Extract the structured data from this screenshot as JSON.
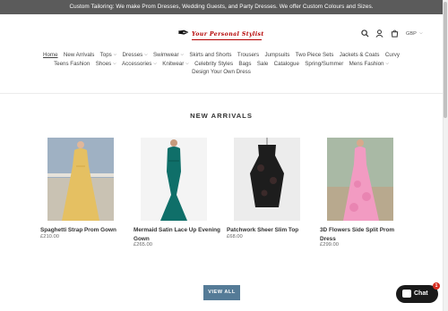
{
  "announcement": "Custom Tailoring: We make Prom Dresses, Wedding Guests, and Party Dresses. We offer Custom Colours and Sizes.",
  "logo": {
    "text": "Your Personal Stylist"
  },
  "header": {
    "currency": "GBP"
  },
  "nav": {
    "row1": [
      {
        "label": "Home",
        "caret": false
      },
      {
        "label": "New Arrivals",
        "caret": false
      },
      {
        "label": "Tops",
        "caret": true
      },
      {
        "label": "Dresses",
        "caret": true
      },
      {
        "label": "Swimwear",
        "caret": true
      },
      {
        "label": "Skirts and Shorts",
        "caret": false
      },
      {
        "label": "Trousers",
        "caret": false
      },
      {
        "label": "Jumpsuits",
        "caret": false
      },
      {
        "label": "Two Piece Sets",
        "caret": false
      },
      {
        "label": "Jackets & Coats",
        "caret": false
      },
      {
        "label": "Curvy",
        "caret": false
      }
    ],
    "row2": [
      {
        "label": "Teens Fashion",
        "caret": false
      },
      {
        "label": "Shoes",
        "caret": true
      },
      {
        "label": "Accessories",
        "caret": true
      },
      {
        "label": "Knitwear",
        "caret": true
      },
      {
        "label": "Celebrity Styles",
        "caret": false
      },
      {
        "label": "Bags",
        "caret": false
      },
      {
        "label": "Sale",
        "caret": false
      },
      {
        "label": "Catalogue",
        "caret": false
      },
      {
        "label": "Spring/Summer",
        "caret": false
      },
      {
        "label": "Mens Fashion",
        "caret": true
      }
    ],
    "row3": [
      {
        "label": "Design Your Own Dress",
        "caret": false
      }
    ]
  },
  "section": {
    "title": "NEW ARRIVALS"
  },
  "products": [
    {
      "title": "Spaghetti Strap Prom Gown",
      "price": "£210.00"
    },
    {
      "title": "Mermaid Satin Lace Up Evening Gown",
      "price": "£265.00"
    },
    {
      "title": "Patchwork Sheer Slim Top",
      "price": "£68.00"
    },
    {
      "title": "3D Flowers Side Split Prom Dress",
      "price": "£299.00"
    }
  ],
  "view_all": "VIEW ALL",
  "chat": {
    "label": "Chat",
    "badge": "1"
  },
  "colors": {
    "announcement_bg": "#5b5b5b",
    "button": "#557b97",
    "logo": "#b30000",
    "chat": "#1a1a1a"
  }
}
